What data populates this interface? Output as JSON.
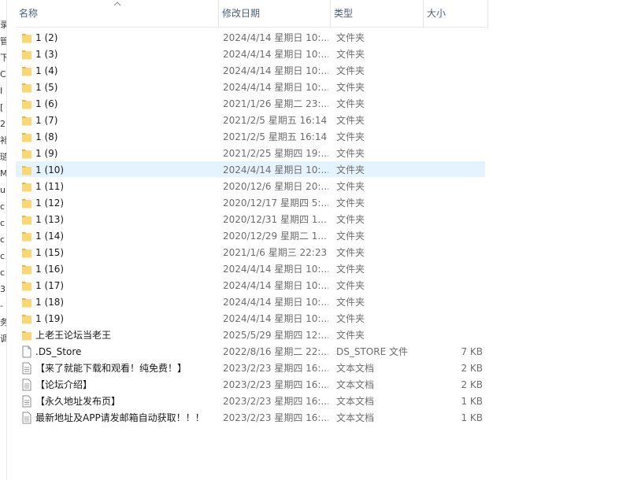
{
  "columns": {
    "name": "名称",
    "date": "修改日期",
    "type": "类型",
    "size": "大小"
  },
  "left_strip_chars": [
    "录",
    "管",
    "下",
    "C",
    "I",
    "[",
    "2",
    "补",
    "琏",
    "M",
    "u",
    "c",
    "c",
    "c",
    "c",
    "c",
    "3",
    "-",
    "务",
    "调"
  ],
  "files": [
    {
      "name": "1 (2)",
      "date": "2024/4/14 星期日 10:...",
      "type": "文件夹",
      "size": "",
      "icon": "folder-icon"
    },
    {
      "name": "1 (3)",
      "date": "2024/4/14 星期日 10:...",
      "type": "文件夹",
      "size": "",
      "icon": "folder-icon"
    },
    {
      "name": "1 (4)",
      "date": "2024/4/14 星期日 10:...",
      "type": "文件夹",
      "size": "",
      "icon": "folder-icon"
    },
    {
      "name": "1 (5)",
      "date": "2024/4/14 星期日 10:...",
      "type": "文件夹",
      "size": "",
      "icon": "folder-icon"
    },
    {
      "name": "1 (6)",
      "date": "2021/1/26 星期二 23:...",
      "type": "文件夹",
      "size": "",
      "icon": "folder-icon"
    },
    {
      "name": "1 (7)",
      "date": "2021/2/5 星期五 16:14",
      "type": "文件夹",
      "size": "",
      "icon": "folder-icon"
    },
    {
      "name": "1 (8)",
      "date": "2021/2/5 星期五 16:14",
      "type": "文件夹",
      "size": "",
      "icon": "folder-icon"
    },
    {
      "name": "1 (9)",
      "date": "2021/2/25 星期四 19:...",
      "type": "文件夹",
      "size": "",
      "icon": "folder-icon"
    },
    {
      "name": "1 (10)",
      "date": "2024/4/14 星期日 10:...",
      "type": "文件夹",
      "size": "",
      "icon": "folder-icon",
      "selected": true
    },
    {
      "name": "1 (11)",
      "date": "2020/12/6 星期日 20:...",
      "type": "文件夹",
      "size": "",
      "icon": "folder-icon"
    },
    {
      "name": "1 (12)",
      "date": "2020/12/17 星期四 5:...",
      "type": "文件夹",
      "size": "",
      "icon": "folder-icon"
    },
    {
      "name": "1 (13)",
      "date": "2020/12/31 星期四 1...",
      "type": "文件夹",
      "size": "",
      "icon": "folder-icon"
    },
    {
      "name": "1 (14)",
      "date": "2020/12/29 星期二 1...",
      "type": "文件夹",
      "size": "",
      "icon": "folder-icon"
    },
    {
      "name": "1 (15)",
      "date": "2021/1/6 星期三 22:23",
      "type": "文件夹",
      "size": "",
      "icon": "folder-icon"
    },
    {
      "name": "1 (16)",
      "date": "2024/4/14 星期日 10:...",
      "type": "文件夹",
      "size": "",
      "icon": "folder-icon"
    },
    {
      "name": "1 (17)",
      "date": "2024/4/14 星期日 10:...",
      "type": "文件夹",
      "size": "",
      "icon": "folder-icon"
    },
    {
      "name": "1 (18)",
      "date": "2024/4/14 星期日 10:...",
      "type": "文件夹",
      "size": "",
      "icon": "folder-icon"
    },
    {
      "name": "1 (19)",
      "date": "2024/4/14 星期日 10:...",
      "type": "文件夹",
      "size": "",
      "icon": "folder-icon"
    },
    {
      "name": "上老王论坛当老王",
      "date": "2025/5/29 星期四 12:...",
      "type": "文件夹",
      "size": "",
      "icon": "folder-icon"
    },
    {
      "name": ".DS_Store",
      "date": "2022/8/16 星期二 22:...",
      "type": "DS_STORE 文件",
      "size": "7 KB",
      "icon": "file-icon"
    },
    {
      "name": "【来了就能下载和观看！纯免费！】",
      "date": "2023/2/23 星期四 16:...",
      "type": "文本文档",
      "size": "2 KB",
      "icon": "text-file-icon"
    },
    {
      "name": "【论坛介绍】",
      "date": "2023/2/23 星期四 16:...",
      "type": "文本文档",
      "size": "2 KB",
      "icon": "text-file-icon"
    },
    {
      "name": "【永久地址发布页】",
      "date": "2023/2/23 星期四 16:...",
      "type": "文本文档",
      "size": "1 KB",
      "icon": "text-file-icon"
    },
    {
      "name": "最新地址及APP请发邮箱自动获取！！！",
      "date": "2023/2/23 星期四 16:...",
      "type": "文本文档",
      "size": "1 KB",
      "icon": "text-file-icon"
    }
  ],
  "colors": {
    "folder": "#f8d775",
    "folder_dark": "#e8b84a",
    "selected": "#e5f3ff",
    "header_text": "#4c607a"
  }
}
